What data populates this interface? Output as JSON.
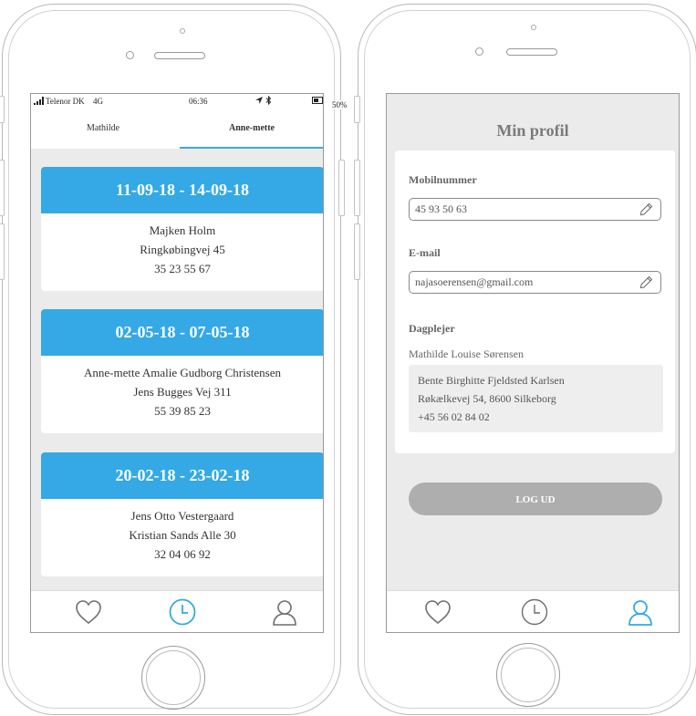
{
  "left_phone": {
    "status": {
      "carrier": "Telenor DK",
      "network": "4G",
      "time": "06:36",
      "battery": "50%"
    },
    "tabs": [
      {
        "label": "Mathilde",
        "active": false
      },
      {
        "label": "Anne-mette",
        "active": true
      }
    ],
    "bookings": [
      {
        "dates": "11-09-18 - 14-09-18",
        "name": "Majken Holm",
        "address": "Ringkøbingvej 45",
        "phone": "35 23 55 67"
      },
      {
        "dates": "02-05-18 - 07-05-18",
        "name": "Anne-mette Amalie Gudborg Christensen",
        "address": "Jens Bugges Vej 311",
        "phone": "55 39 85 23"
      },
      {
        "dates": "20-02-18 - 23-02-18",
        "name": "Jens Otto Vestergaard",
        "address": "Kristian Sands Alle 30",
        "phone": "32 04 06 92"
      }
    ],
    "nav": {
      "active": "clock-icon"
    }
  },
  "right_phone": {
    "title": "Min profil",
    "mobile": {
      "label": "Mobilnummer",
      "value": "45 93 50 63"
    },
    "email": {
      "label": "E-mail",
      "value": "najasoerensen@gmail.com"
    },
    "dagplejer": {
      "label": "Dagplejer",
      "child": "Mathilde Louise Sørensen",
      "name": "Bente Birghitte Fjeldsted Karlsen",
      "address": "Røkælkevej 54, 8600 Silkeborg",
      "phone": "+45 56 02 84 02"
    },
    "logout_label": "LOG UD",
    "nav": {
      "active": "user-icon"
    }
  },
  "colors": {
    "accent": "#34a9e5",
    "muted": "#aeaeae",
    "icon": "#6d6d6d"
  }
}
